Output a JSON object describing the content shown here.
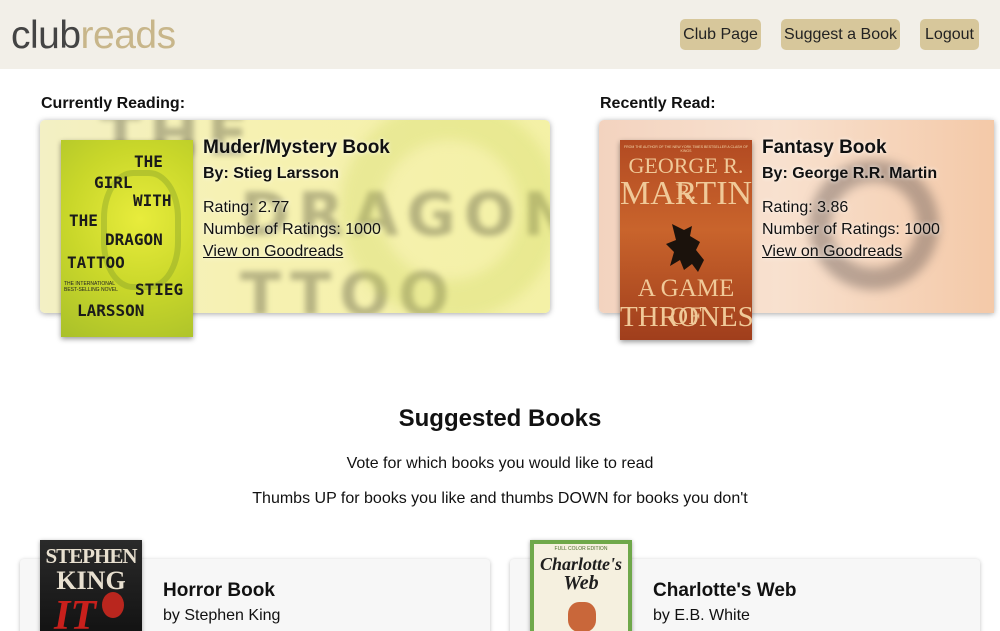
{
  "brand": {
    "part1": "club",
    "part2": "reads"
  },
  "nav": {
    "club_page": "Club Page",
    "suggest": "Suggest a Book",
    "logout": "Logout"
  },
  "current": {
    "label": "Currently Reading:",
    "title": "Muder/Mystery Book",
    "author": "By: Stieg Larsson",
    "rating": "Rating: 2.77",
    "num_ratings": "Number of Ratings: 1000",
    "link": "View on Goodreads",
    "cover_lines": [
      "THE",
      "GIRL",
      "WITH",
      "THE",
      "DRAGON",
      "TATTOO"
    ],
    "cover_small": "THE INTERNATIONAL BEST-SELLING NOVEL",
    "cover_author1": "STIEG",
    "cover_author2": "LARSSON"
  },
  "recent": {
    "label": "Recently Read:",
    "title": "Fantasy Book",
    "author": "By: George R.R. Martin",
    "rating": "Rating: 3.86",
    "num_ratings": "Number of Ratings: 1000",
    "link": "View on Goodreads",
    "cover_top": "FROM THE AUTHOR OF THE NEW YORK TIMES BESTSELLER A CLASH OF KINGS",
    "cover_author1": "GEORGE R. R.",
    "cover_author2": "MARTIN",
    "cover_title1": "A GAME OF",
    "cover_title2": "THRONES"
  },
  "suggested": {
    "title": "Suggested Books",
    "line1": "Vote for which books you would like to read",
    "line2": "Thumbs UP for books you like and thumbs DOWN for books you don't",
    "books": [
      {
        "title": "Horror Book",
        "author": "by Stephen King",
        "cover_author1": "STEPHEN",
        "cover_author2": "KING",
        "cover_title": "IT"
      },
      {
        "title": "Charlotte's Web",
        "author": "by E.B. White",
        "cover_top": "FULL COLOR EDITION",
        "cover_title1": "Charlotte's",
        "cover_title2": "Web"
      }
    ]
  },
  "colors": {
    "topbar": "#f2efe8",
    "nav_button": "#d7c79b",
    "brand_accent": "#c8b68a"
  }
}
